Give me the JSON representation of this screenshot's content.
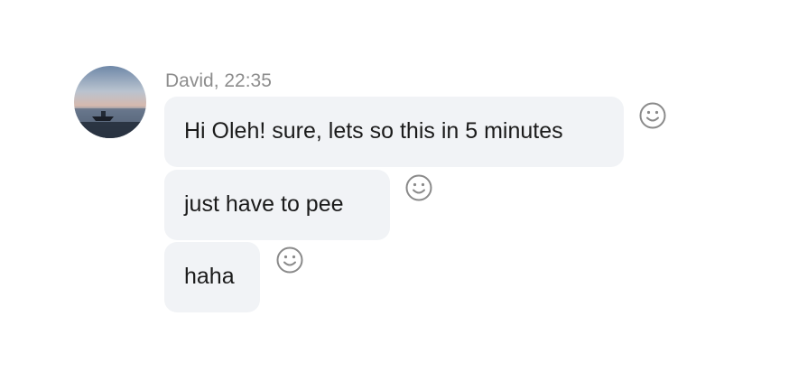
{
  "message_group": {
    "sender": "David",
    "time": "22:35",
    "header": "David, 22:35",
    "avatar_icon": "user-photo-lake-boat",
    "messages": [
      {
        "text": "Hi Oleh! sure, lets so this in 5 minutes",
        "reaction_icon": "smiley-face-icon"
      },
      {
        "text": "just have to pee",
        "reaction_icon": "smiley-face-icon"
      },
      {
        "text": "haha",
        "reaction_icon": "smiley-face-icon"
      }
    ]
  },
  "colors": {
    "bubble_bg": "#f1f3f6",
    "meta_text": "#8d8d8d",
    "message_text": "#1b1b1b",
    "icon_stroke": "#8a8a8a"
  }
}
